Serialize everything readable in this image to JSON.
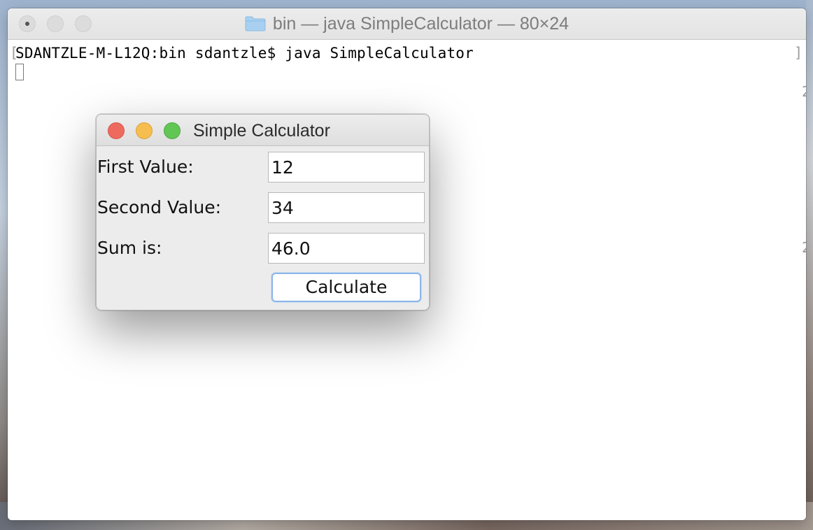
{
  "terminal": {
    "title": "bin — java SimpleCalculator — 80×24",
    "folder_icon": "folder-icon",
    "prompt": "SDANTZLE-M-L12Q:bin sdantzle$ java SimpleCalculator",
    "bracket_left": "[",
    "bracket_right": "]",
    "side_digits": [
      "2",
      "2"
    ]
  },
  "calculator": {
    "title": "Simple Calculator",
    "fields": [
      {
        "label": "First Value:",
        "value": "12"
      },
      {
        "label": "Second Value:",
        "value": "34"
      },
      {
        "label": "Sum is:",
        "value": "46.0"
      }
    ],
    "button_label": "Calculate",
    "colors": {
      "close": "#ee6a5f",
      "minimize": "#f6bd4f",
      "zoom": "#62c655",
      "button_focus": "#8db6e8"
    }
  }
}
